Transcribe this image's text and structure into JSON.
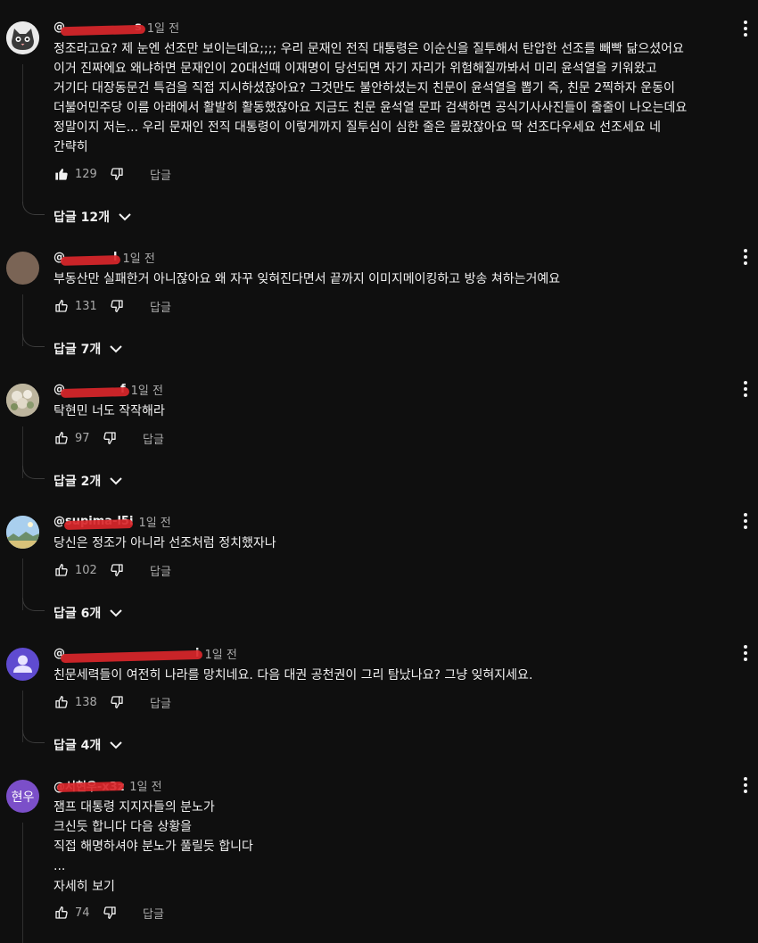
{
  "comments": [
    {
      "handle": "@",
      "handle_suffix": "s",
      "time": "1일 전",
      "text": "정조라고요? 제 눈엔 선조만 보이는데요;;;; 우리 문재인 전직 대통령은 이순신을 질투해서 탄압한 선조를 빼빡 닮으셨어요\n이거 진짜에요 왜냐하면 문재인이 20대선때 이재명이 당선되면 자기 자리가 위험해질까봐서 미리 윤석열을 키워왔고\n거기다 대장동문건 특검을 직접 지시하셨잖아요? 그것만도 불안하셨는지 친문이 윤석열을 뽑기 즉, 친문 2찍하자 운동이\n더불어민주당 이름 아래에서 활발히 활동했잖아요 지금도 친문 윤석열 문파 검색하면 공식기사사진들이 줄줄이 나오는데요\n정말이지 저는... 우리 문재인 전직 대통령이 이렇게까지 질투심이 심한 줄은 몰랐잖아요 딱 선조다우세요 선조세요 네\n간략히",
      "likes": "129",
      "reply_label": "답글",
      "replies_label": "답글 12개",
      "avatar": "cat-avatar"
    },
    {
      "handle": "@",
      "handle_suffix": "l",
      "time": "1일 전",
      "text": "부동산만 실패한거 아니잖아요 왜 자꾸 잊혀진다면서 끝까지 이미지메이킹하고 방송 쳐하는거예요",
      "likes": "131",
      "reply_label": "답글",
      "replies_label": "답글 7개",
      "avatar": "brown-avatar"
    },
    {
      "handle": "@",
      "handle_suffix": "f",
      "time": "1일 전",
      "text": "탁현민 너도 작작해라",
      "likes": "97",
      "reply_label": "답글",
      "replies_label": "답글 2개",
      "avatar": "flower-avatar"
    },
    {
      "handle": "@supima-l5i",
      "handle_suffix": "",
      "time": "1일 전",
      "text": "당신은 정조가 아니라 선조처럼 정치했자나",
      "likes": "102",
      "reply_label": "답글",
      "replies_label": "답글 6개",
      "avatar": "landscape-avatar"
    },
    {
      "handle": "@",
      "handle_suffix": "i",
      "time": "1일 전",
      "text": "친문세력들이 여전히 나라를 망치네요. 다음 대권 공천권이 그리 탐났나요? 그냥 잊혀지세요.",
      "likes": "138",
      "reply_label": "답글",
      "replies_label": "답글 4개",
      "avatar": "default-user-avatar"
    },
    {
      "handle": "@서현우-x3z",
      "handle_suffix": "",
      "time": "1일 전",
      "text": "잼프 대통령 지지자들의 분노가\n크신듯 합니다 다음 상황을\n직접 해명하셔야 분노가 풀릴듯 합니다\n...",
      "more_label": "자세히 보기",
      "likes": "74",
      "reply_label": "답글",
      "avatar_text": "현우",
      "avatar": "letter-avatar"
    }
  ],
  "colors": {
    "background": "#0f0f0f",
    "text": "#f1f1f1",
    "secondary": "#aaaaaa",
    "redaction": "#d9262a",
    "letter_avatar": "#7b4fc9",
    "default_avatar": "#5f4bd0"
  }
}
